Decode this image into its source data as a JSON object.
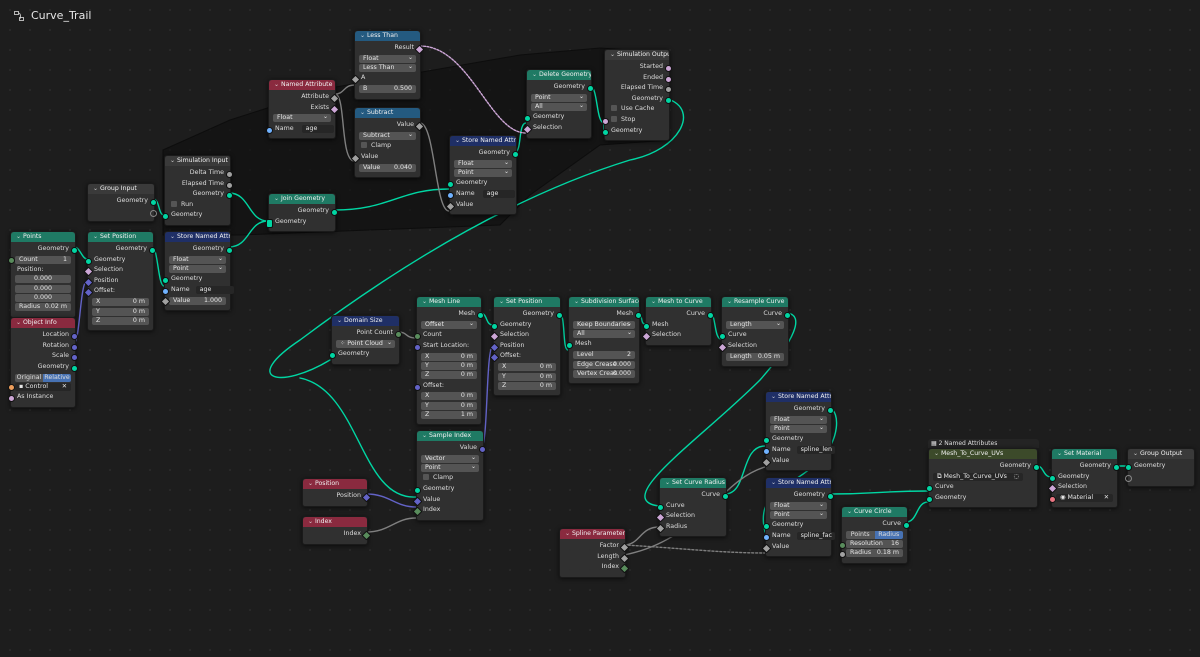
{
  "editor": {
    "tree_name": "Curve_Trail",
    "tree_icon": "node-tree-icon"
  },
  "colors": {
    "geometry_socket": "#00d6a3",
    "float_socket": "#a1a1a1",
    "vector_socket": "#6363c7",
    "integer_socket": "#598c5c",
    "boolean_socket": "#cca6d6",
    "string_socket": "#70b2ff",
    "geometry_header": "#1f7a64",
    "attribute_header": "#1f2f66",
    "input_header": "#8a2a3f",
    "converter_header": "#245a80",
    "background": "#1d1d1d"
  },
  "nodes": {
    "less_than": {
      "title": "Less Than",
      "result": "Result",
      "type": "Float",
      "op": "Less Than",
      "a": "A",
      "b_label": "B",
      "b_value": "0.500"
    },
    "subtract": {
      "title": "Subtract",
      "value_out": "Value",
      "op": "Subtract",
      "clamp": "Clamp",
      "value_in": "Value",
      "value2_label": "Value",
      "value2": "0.040"
    },
    "named_attribute": {
      "title": "Named Attribute",
      "attribute": "Attribute",
      "exists": "Exists",
      "type": "Float",
      "name_label": "Name",
      "name_value": "age"
    },
    "delete_geometry": {
      "title": "Delete Geometry",
      "geometry_out": "Geometry",
      "domain": "Point",
      "mode": "All",
      "geometry_in": "Geometry",
      "selection": "Selection"
    },
    "simulation_output": {
      "title": "Simulation Output",
      "started": "Started",
      "ended": "Ended",
      "elapsed": "Elapsed Time",
      "geometry_out": "Geometry",
      "use_cache": "Use Cache",
      "stop": "Stop",
      "geometry_in": "Geometry"
    },
    "store_named_top": {
      "title": "Store Named Attribute",
      "geometry_out": "Geometry",
      "type": "Float",
      "domain": "Point",
      "geometry_in": "Geometry",
      "name_label": "Name",
      "name_value": "age",
      "value": "Value"
    },
    "simulation_input": {
      "title": "Simulation Input",
      "delta": "Delta Time",
      "elapsed": "Elapsed Time",
      "geometry_out": "Geometry",
      "run": "Run",
      "geometry_in": "Geometry"
    },
    "group_input": {
      "title": "Group Input",
      "geometry": "Geometry"
    },
    "join_geometry": {
      "title": "Join Geometry",
      "geometry_out": "Geometry",
      "geometry_in": "Geometry"
    },
    "points": {
      "title": "Points",
      "geometry": "Geometry",
      "count_label": "Count",
      "count": "1",
      "position_label": "Position:",
      "pos_x": "0.000",
      "pos_y": "0.000",
      "pos_z": "0.000",
      "radius_label": "Radius",
      "radius": "0.02 m"
    },
    "set_position_left": {
      "title": "Set Position",
      "geometry_out": "Geometry",
      "geometry_in": "Geometry",
      "selection": "Selection",
      "position": "Position",
      "offset": "Offset:",
      "x": "X",
      "y": "Y",
      "z": "Z",
      "xv": "0 m",
      "yv": "0 m",
      "zv": "0 m"
    },
    "store_named_left": {
      "title": "Store Named Attribute",
      "geometry_out": "Geometry",
      "type": "Float",
      "domain": "Point",
      "geometry_in": "Geometry",
      "name_label": "Name",
      "name_value": "age",
      "value_label": "Value",
      "value": "1.000"
    },
    "object_info": {
      "title": "Object Info",
      "location": "Location",
      "rotation": "Rotation",
      "scale": "Scale",
      "geometry": "Geometry",
      "original": "Original",
      "relative": "Relative",
      "object": "Control",
      "as_instance": "As Instance"
    },
    "domain_size": {
      "title": "Domain Size",
      "point_count": "Point Count",
      "component": "Point Cloud",
      "geometry": "Geometry"
    },
    "mesh_line": {
      "title": "Mesh Line",
      "mesh": "Mesh",
      "mode": "Offset",
      "count": "Count",
      "start_label": "Start Location:",
      "x": "X",
      "y": "Y",
      "z": "Z",
      "sx": "0 m",
      "sy": "0 m",
      "sz": "0 m",
      "offset_label": "Offset:",
      "ox": "0 m",
      "oy": "0 m",
      "oz": "1 m"
    },
    "set_position_mid": {
      "title": "Set Position",
      "geometry_out": "Geometry",
      "geometry_in": "Geometry",
      "selection": "Selection",
      "position": "Position",
      "offset": "Offset:",
      "x": "X",
      "y": "Y",
      "z": "Z",
      "xv": "0 m",
      "yv": "0 m",
      "zv": "0 m"
    },
    "subdivision_surface": {
      "title": "Subdivision Surface",
      "mesh_out": "Mesh",
      "boundary": "Keep Boundaries",
      "uv": "All",
      "mesh_in": "Mesh",
      "level_label": "Level",
      "level": "2",
      "edge_label": "Edge Crease",
      "edge": "0.000",
      "vertex_label": "Vertex Creas",
      "vertex": "0.000"
    },
    "mesh_to_curve": {
      "title": "Mesh to Curve",
      "curve": "Curve",
      "mesh": "Mesh",
      "selection": "Selection"
    },
    "resample_curve": {
      "title": "Resample Curve",
      "curve_out": "Curve",
      "mode": "Length",
      "curve_in": "Curve",
      "selection": "Selection",
      "length_label": "Length",
      "length": "0.05 m"
    },
    "sample_index": {
      "title": "Sample Index",
      "value_out": "Value",
      "type": "Vector",
      "domain": "Point",
      "clamp": "Clamp",
      "geometry": "Geometry",
      "value_in": "Value",
      "index": "Index"
    },
    "position": {
      "title": "Position",
      "out": "Position"
    },
    "index": {
      "title": "Index",
      "out": "Index"
    },
    "spline_parameter": {
      "title": "Spline Parameter",
      "factor": "Factor",
      "length": "Length",
      "index": "Index"
    },
    "set_curve_radius": {
      "title": "Set Curve Radius",
      "curve_out": "Curve",
      "curve_in": "Curve",
      "selection": "Selection",
      "radius": "Radius"
    },
    "store_named_len": {
      "title": "Store Named Attribute",
      "geometry_out": "Geometry",
      "type": "Float",
      "domain": "Point",
      "geometry_in": "Geometry",
      "name_label": "Name",
      "name_value": "spline_len",
      "value": "Value"
    },
    "store_named_fac": {
      "title": "Store Named Attribute",
      "geometry_out": "Geometry",
      "type": "Float",
      "domain": "Point",
      "geometry_in": "Geometry",
      "name_label": "Name",
      "name_value": "spline_fac",
      "value": "Value"
    },
    "curve_circle": {
      "title": "Curve Circle",
      "curve": "Curve",
      "points": "Points",
      "radius_tab": "Radius",
      "resolution_label": "Resolution",
      "resolution": "16",
      "radius_label": "Radius",
      "radius": "0.18 m"
    },
    "mesh_to_curve_uvs": {
      "label": "2 Named Attributes",
      "title": "Mesh_To_Curve_UVs",
      "geometry_out": "Geometry",
      "group": "Mesh_To_Curve_UVs",
      "curve": "Curve",
      "geometry_in": "Geometry"
    },
    "set_material": {
      "title": "Set Material",
      "geometry_out": "Geometry",
      "geometry_in": "Geometry",
      "selection": "Selection",
      "material": "Material"
    },
    "group_output": {
      "title": "Group Output",
      "geometry": "Geometry"
    }
  }
}
